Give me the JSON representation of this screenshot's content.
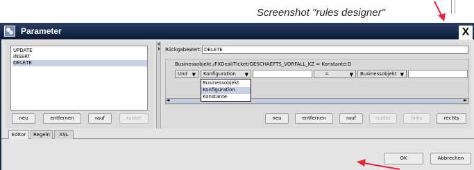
{
  "caption": "Screenshot \"rules designer\"",
  "window": {
    "title": "Parameter",
    "close_glyph": "X"
  },
  "left": {
    "items": [
      {
        "label": "UPDATE",
        "selected": false
      },
      {
        "label": "INSERT",
        "selected": false
      },
      {
        "label": "DELETE",
        "selected": true
      }
    ],
    "buttons": {
      "neu": "neu",
      "entfernen": "entfernen",
      "rauf": "rauf",
      "runter": "runter"
    }
  },
  "right": {
    "return_label": "Rückgabewert:",
    "return_value": "DELETE",
    "expression": "Businessobjekt./FXDeal/Ticket/GESCHAEFTS_VORFALL_KZ = Konstante:D",
    "row": {
      "logic": "Und",
      "category": "Konfiguration",
      "operator": "=",
      "target": "Businessobjekt"
    },
    "dropdown_options": [
      {
        "label": "Businessobjekt",
        "selected": false
      },
      {
        "label": "Konfiguration",
        "selected": true
      },
      {
        "label": "Konstante",
        "selected": false
      }
    ],
    "buttons": {
      "neu": "neu",
      "entfernen": "entfernen",
      "rauf": "rauf",
      "runter": "runter",
      "links": "links",
      "rechts": "rechts"
    }
  },
  "tabs": [
    "Editor",
    "Regeln",
    "XSL"
  ],
  "footer": {
    "ok": "OK",
    "cancel": "Abbrechen"
  },
  "colors": {
    "titlebar": "#0c1a36",
    "arrow": "#e0243a",
    "selection": "#c8d0e6"
  }
}
